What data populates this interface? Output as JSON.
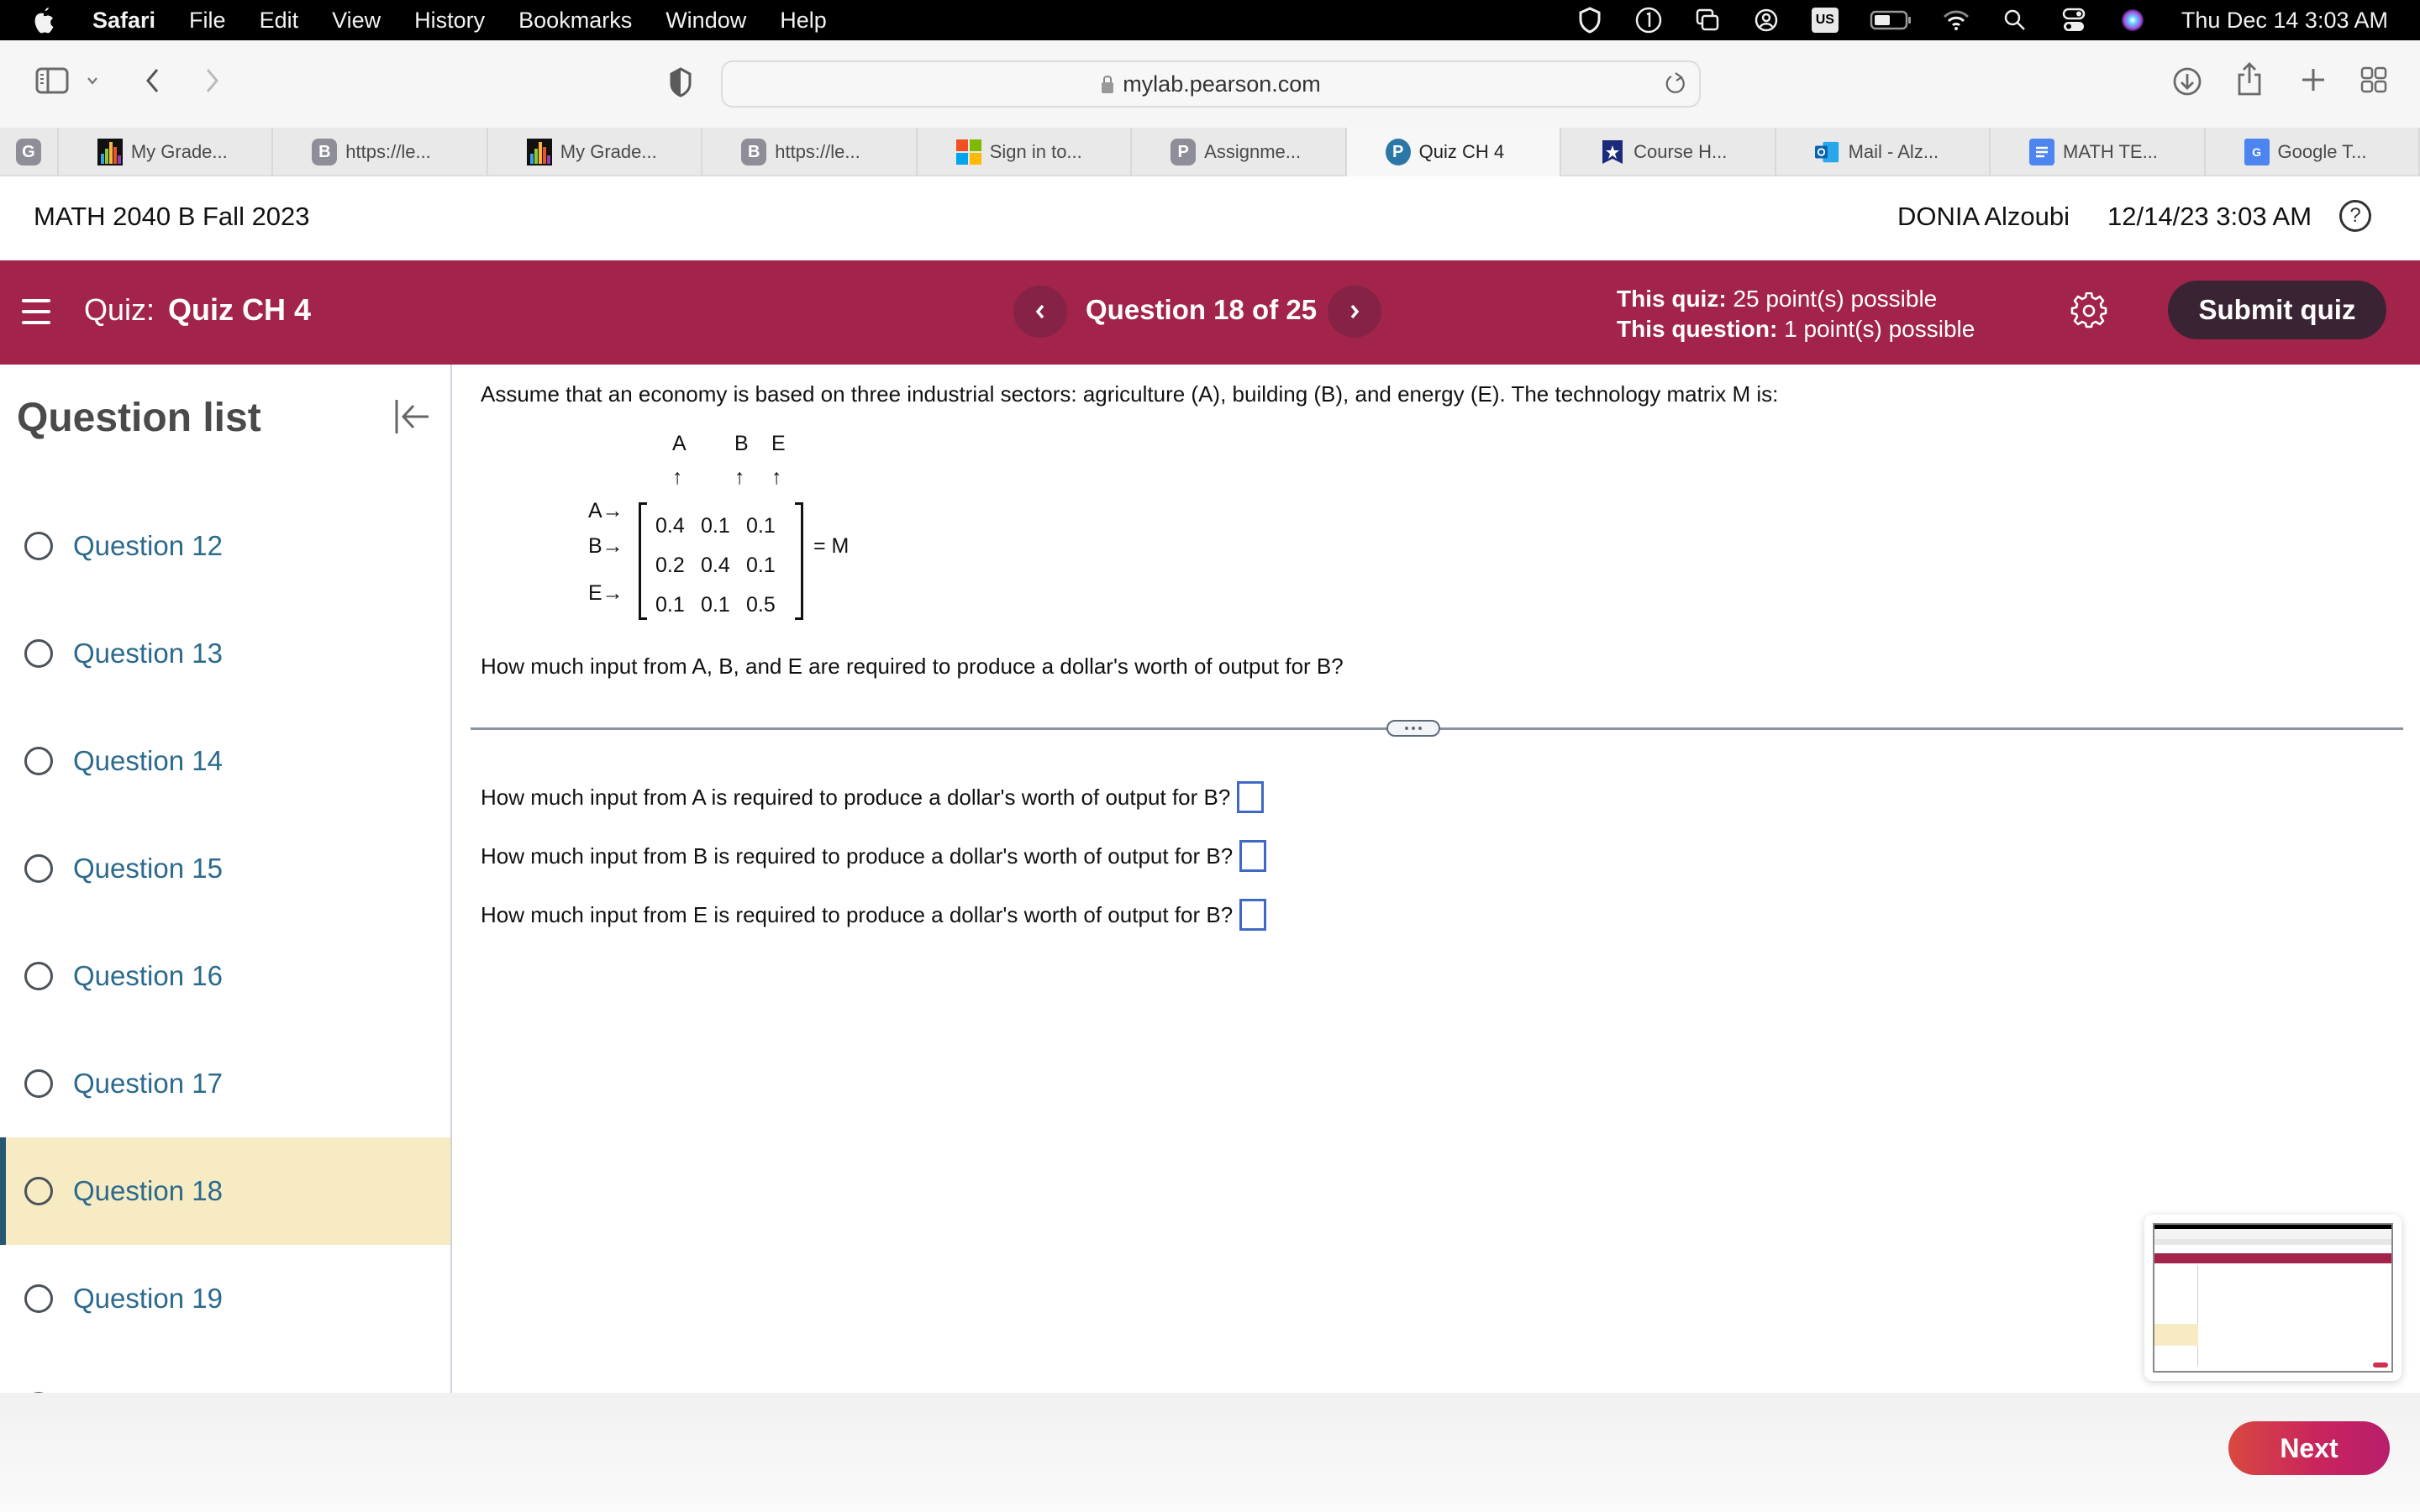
{
  "menubar": {
    "app": "Safari",
    "items": [
      "File",
      "Edit",
      "View",
      "History",
      "Bookmarks",
      "Window",
      "Help"
    ],
    "input_source": "US",
    "clock": "Thu Dec 14  3:03 AM"
  },
  "browser": {
    "url": "mylab.pearson.com",
    "tabs": [
      {
        "label": "My Grade...",
        "icon": "gradebook-icon"
      },
      {
        "label": "https://le...",
        "icon": "b-letter-icon"
      },
      {
        "label": "My Grade...",
        "icon": "gradebook-icon"
      },
      {
        "label": "https://le...",
        "icon": "b-letter-icon"
      },
      {
        "label": "Sign in to...",
        "icon": "microsoft-icon"
      },
      {
        "label": "Assignme...",
        "icon": "p-letter-icon"
      },
      {
        "label": "Quiz CH 4",
        "icon": "pearson-icon",
        "active": true
      },
      {
        "label": "Course H...",
        "icon": "star-shield-icon"
      },
      {
        "label": "Mail - Alz...",
        "icon": "outlook-icon"
      },
      {
        "label": "MATH TE...",
        "icon": "google-docs-icon"
      },
      {
        "label": "Google T...",
        "icon": "google-translate-icon"
      }
    ],
    "pinned_tab_letter": "G"
  },
  "course_header": {
    "course_title": "MATH 2040 B Fall 2023",
    "user_name": "DONIA Alzoubi",
    "datetime": "12/14/23 3:03 AM",
    "help_symbol": "?"
  },
  "quizbar": {
    "quiz_label": "Quiz:",
    "quiz_name": "Quiz CH 4",
    "question_counter": "Question 18 of 25",
    "this_quiz_label": "This quiz:",
    "this_quiz_value": "25 point(s) possible",
    "this_question_label": "This question:",
    "this_question_value": "1 point(s) possible",
    "submit_label": "Submit quiz",
    "colors": {
      "bar": "#a2244b",
      "submit": "#3a2434"
    }
  },
  "sidebar": {
    "title": "Question list",
    "items": [
      {
        "label": "Question 12"
      },
      {
        "label": "Question 13"
      },
      {
        "label": "Question 14"
      },
      {
        "label": "Question 15"
      },
      {
        "label": "Question 16"
      },
      {
        "label": "Question 17"
      },
      {
        "label": "Question 18",
        "current": true
      },
      {
        "label": "Question 19"
      }
    ]
  },
  "question": {
    "prompt": "Assume that an economy is based on three industrial sectors: agriculture (A), building (B), and energy (E). The technology matrix M is:",
    "matrix": {
      "col_labels": [
        "A",
        "B",
        "E"
      ],
      "row_labels": [
        "A→",
        "B→",
        "E→"
      ],
      "up_arrow": "↑",
      "rows": [
        [
          "0.4",
          "0.1",
          "0.1"
        ],
        [
          "0.2",
          "0.4",
          "0.1"
        ],
        [
          "0.1",
          "0.1",
          "0.5"
        ]
      ],
      "equals_label": "= M"
    },
    "subprompt": "How much input from A, B, and E are required to produce a dollar's worth of output for B?",
    "answers": [
      {
        "label": "How much input from A is required to produce a dollar's worth of output for B?",
        "value": ""
      },
      {
        "label": "How much input from B is required to produce a dollar's worth of output for B?",
        "value": ""
      },
      {
        "label": "How much input from E is required to produce a dollar's worth of output for B?",
        "value": ""
      }
    ]
  },
  "footer": {
    "next_label": "Next"
  }
}
